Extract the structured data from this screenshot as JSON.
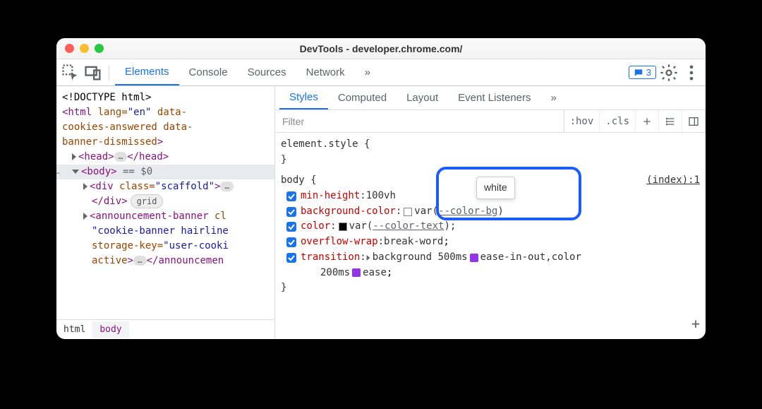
{
  "window": {
    "title": "DevTools - developer.chrome.com/"
  },
  "toolbar": {
    "tabs": [
      "Elements",
      "Console",
      "Sources",
      "Network"
    ],
    "active_tab": "Elements",
    "overflow": "»",
    "message_count": "3"
  },
  "dom": {
    "doctype": "<!DOCTYPE html>",
    "html_open_1": "<html lang=\"en\" data-",
    "html_open_2": "cookies-answered data-",
    "html_open_3": "banner-dismissed>",
    "head_open": "<head>",
    "head_close": "</head>",
    "body_open": "<body>",
    "body_equals": " == ",
    "body_dollar": "$0",
    "div_scaffold_open": "<div class=\"scaffold\">",
    "div_close": "</div>",
    "grid_badge": "grid",
    "ann_open_1": "<announcement-banner cl",
    "ann_attr_1": "\"cookie-banner hairline",
    "ann_attr_2": "storage-key=\"user-cooki",
    "ann_attr_3_pre": "active>",
    "ann_close": "</announcemen"
  },
  "breadcrumbs": [
    "html",
    "body"
  ],
  "subtabs": {
    "items": [
      "Styles",
      "Computed",
      "Layout",
      "Event Listeners"
    ],
    "active": "Styles",
    "overflow": "»"
  },
  "filter": {
    "placeholder": "Filter",
    "hov": ":hov",
    "cls": ".cls"
  },
  "styles": {
    "element_style": "element.style {",
    "body_selector": "body {",
    "source_link": "(index):1",
    "props": {
      "min_height": {
        "name": "min-height",
        "value": "100vh"
      },
      "background_color": {
        "name": "background-color",
        "var": "--color-bg"
      },
      "color": {
        "name": "color",
        "var": "--color-text"
      },
      "overflow_wrap": {
        "name": "overflow-wrap",
        "value": "break-word"
      },
      "transition": {
        "name": "transition",
        "seg1": "background 500ms",
        "seg1b": "ease-in-out,color",
        "seg2": "200ms",
        "seg2b": "ease"
      }
    },
    "close_brace": "}",
    "tooltip": "white"
  }
}
